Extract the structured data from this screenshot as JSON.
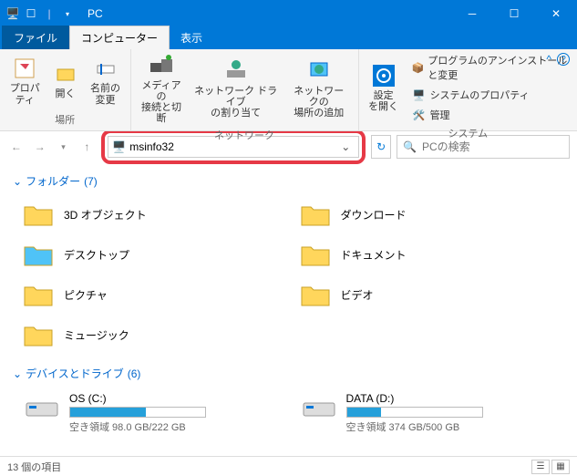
{
  "window": {
    "title": "PC"
  },
  "tabs": {
    "file": "ファイル",
    "computer": "コンピューター",
    "view": "表示"
  },
  "ribbon": {
    "properties": "プロパティ",
    "open": "開く",
    "rename": "名前の\n変更",
    "group_location": "場所",
    "media": "メディアの\n接続と切断",
    "netdrive": "ネットワーク ドライブ\nの割り当て",
    "addnet": "ネットワークの\n場所の追加",
    "group_network": "ネットワーク",
    "settings": "設定\nを開く",
    "uninstall": "プログラムのアンインストールと変更",
    "sysprop": "システムのプロパティ",
    "manage": "管理",
    "group_system": "システム"
  },
  "address": {
    "value": "msinfo32"
  },
  "search": {
    "placeholder": "PCの検索"
  },
  "sections": {
    "folders": {
      "label": "フォルダー",
      "count": "(7)"
    },
    "drives": {
      "label": "デバイスとドライブ",
      "count": "(6)"
    }
  },
  "folders": [
    {
      "name": "3D オブジェクト",
      "color": "#ffd65c"
    },
    {
      "name": "ダウンロード",
      "color": "#ffd65c"
    },
    {
      "name": "デスクトップ",
      "color": "#4fc3f7"
    },
    {
      "name": "ドキュメント",
      "color": "#ffd65c"
    },
    {
      "name": "ピクチャ",
      "color": "#ffd65c"
    },
    {
      "name": "ビデオ",
      "color": "#ffd65c"
    },
    {
      "name": "ミュージック",
      "color": "#ffd65c"
    }
  ],
  "drives": [
    {
      "name": "OS (C:)",
      "free_text": "空き領域 98.0 GB/222 GB",
      "fill_pct": 56
    },
    {
      "name": "DATA (D:)",
      "free_text": "空き領域 374 GB/500 GB",
      "fill_pct": 25
    }
  ],
  "status": {
    "count": "13 個の項目"
  }
}
